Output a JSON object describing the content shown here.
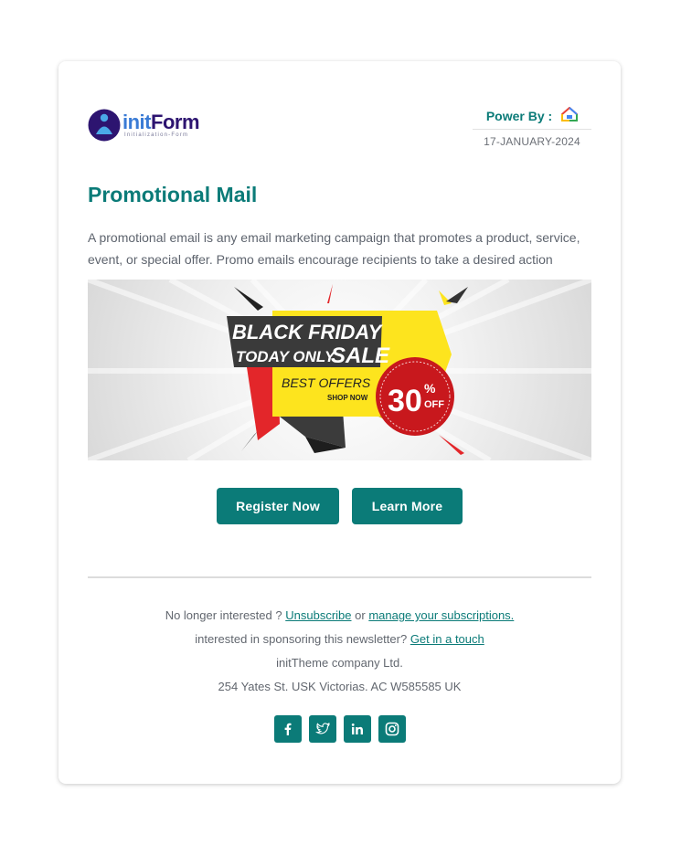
{
  "brand": {
    "logo_word_part1": "init",
    "logo_word_part2": "Form",
    "logo_tagline": "Initialization-Form"
  },
  "header": {
    "power_by_label": "Power By :",
    "date": "17-JANUARY-2024",
    "power_icon": "house-icon"
  },
  "main": {
    "title": "Promotional Mail",
    "intro": "A promotional email is any email marketing campaign that promotes a product, service, event, or special offer. Promo emails encourage recipients to take a desired action"
  },
  "banner": {
    "line1": "BLACK FRIDAY",
    "line2a": "TODAY ONLY",
    "line2b": "SALE",
    "offer": "BEST OFFERS",
    "shop": "SHOP NOW",
    "discount_number": "30",
    "discount_percent": "%",
    "discount_off": "OFF"
  },
  "buttons": {
    "register": "Register Now",
    "learn": "Learn More"
  },
  "footer": {
    "no_longer": "No longer interested ?",
    "unsubscribe": "Unsubscribe",
    "or": "or",
    "manage": "manage your subscriptions.",
    "sponsoring": "interested in sponsoring this newsletter?",
    "get_in_touch": "Get in a touch",
    "company": "initTheme company Ltd.",
    "address": "254 Yates St. USK Victorias. AC W585585 UK"
  },
  "social": [
    "facebook-icon",
    "twitter-icon",
    "linkedin-icon",
    "instagram-icon"
  ],
  "colors": {
    "accent": "#0b7b78",
    "banner_yellow": "#fde41e",
    "banner_red": "#e3262a",
    "banner_dark": "#333333"
  }
}
